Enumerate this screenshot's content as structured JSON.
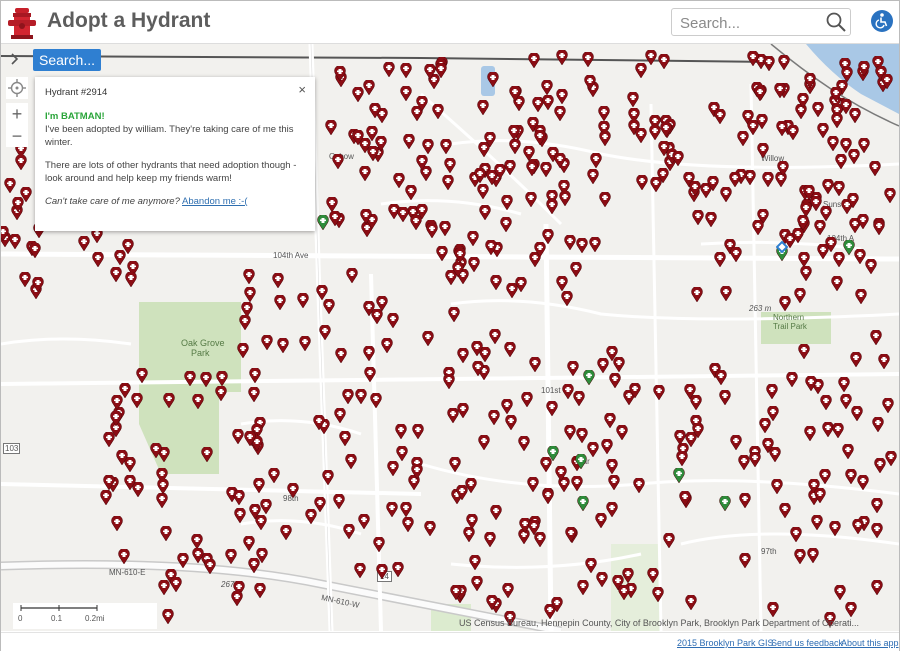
{
  "header": {
    "title": "Adopt a Hydrant",
    "search_placeholder": "Search...",
    "logo_icon": "fire-hydrant-icon",
    "accessibility_icon": "wheelchair-icon"
  },
  "map": {
    "search_button": "Search...",
    "zoom_in": "+",
    "zoom_out": "−",
    "toggle_icon": "chevron-right-icon",
    "locate_icon": "crosshair-icon",
    "labels": [
      {
        "text": "Oxbow"
      },
      {
        "text": "Willow"
      },
      {
        "text": "Sunset"
      },
      {
        "text": "104th A"
      },
      {
        "text": "104th Ave"
      },
      {
        "text": "Oak Grove"
      },
      {
        "text": "Park"
      },
      {
        "text": "Northern"
      },
      {
        "text": "Trail Park"
      },
      {
        "text": "263 m"
      },
      {
        "text": "267 m"
      },
      {
        "text": "MN-610-E"
      },
      {
        "text": "MN-610-W"
      },
      {
        "text": "101st"
      },
      {
        "text": "98th"
      },
      {
        "text": "97th"
      },
      {
        "text": "14"
      },
      {
        "text": "103"
      },
      {
        "text": "Mar"
      }
    ],
    "attribution": "US Census Bureau, Hennepin County, City of Brooklyn Park, Brooklyn Park Department of Operati...",
    "scale": {
      "labels": [
        "0",
        "0.1",
        "0.2mi"
      ]
    },
    "pin_colors": {
      "unadopted": "#8b0d14",
      "adopted": "#2e8b3a"
    }
  },
  "popup": {
    "title": "Hydrant #2914",
    "close": "×",
    "greeting": "I'm BATMAN!",
    "adopted_prefix": "I've been adopted by william.",
    "adopted_suffix": " They're taking care of me this winter.",
    "message": "There are lots of other hydrants that need adoption though - look around and help keep my friends warm!",
    "abandon_prompt": "Can't take care of me anymore?",
    "abandon_link": "Abandon me :-("
  },
  "footer": {
    "copyright": "2015 Brooklyn Park GIS",
    "feedback": "Send us feedback",
    "about": "About this app"
  }
}
